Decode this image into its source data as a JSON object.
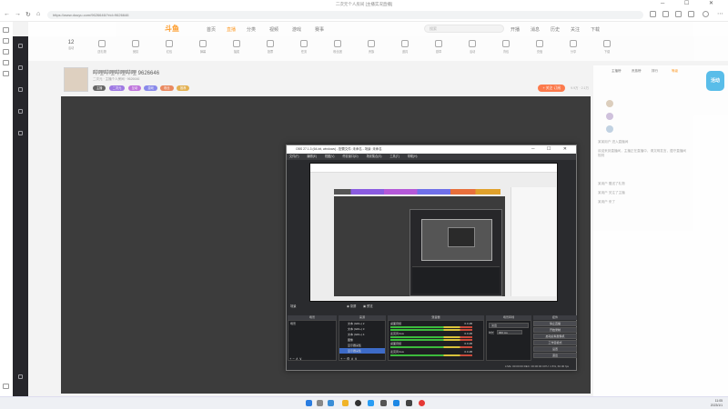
{
  "browser": {
    "title": "二次元个人房间 [主播实况直播]",
    "url": "https://www.douyu.com/9626646/?rid=9626646"
  },
  "site": {
    "logo": "斗鱼",
    "nav": [
      "首页",
      "直播",
      "分类",
      "视频",
      "游戏",
      "赛事",
      "鱼吧"
    ],
    "search_placeholder": "搜索",
    "actions": [
      "开播",
      "消息",
      "历史",
      "关注",
      "下载"
    ],
    "icon_row": [
      "送礼物",
      "竞猜",
      "红包",
      "弹幕",
      "抽奖",
      "投票",
      "任务",
      "粉丝团",
      "贵族",
      "道具",
      "勋章",
      "活动",
      "背包",
      "充值",
      "分享",
      "下载"
    ],
    "activity_badge": "12",
    "activity_label": "活动"
  },
  "room": {
    "title": "哔哩哔哩哔哩哔哩 9626646",
    "meta": "二次元 · 主播个人房间 · 9626646",
    "tags": [
      "主播",
      "二次元",
      "互动",
      "游戏",
      "粉丝",
      "推荐"
    ],
    "follow_button": "+ 关注 订阅",
    "stats": "9.9万 · 2.1万"
  },
  "obs": {
    "title": "OBS 27.1.3 (64-bit, windows) - 配置文件: 未命名 - 场景: 未命名",
    "menu": [
      "文件(F)",
      "编辑(E)",
      "视图(V)",
      "停靠窗口(D)",
      "场景集合(S)",
      "工具(T)",
      "帮助(H)"
    ],
    "studio_mode": "录屏",
    "preview_mode": "预览",
    "current_scene": "场景",
    "docks": {
      "scenes": "场景",
      "sources": "来源",
      "mixer": "混音器",
      "transitions": "场景转场",
      "controls": "控件"
    },
    "scene_items": [
      "场景"
    ],
    "source_items": [
      "文本 (GDI+) 2",
      "文本 (GDI+) 3",
      "文本 (GDI+) 4",
      "图像",
      "显示器采集",
      "显示器采集"
    ],
    "mixer_channels": [
      {
        "name": "桌面音频",
        "level": "0.0 dB"
      },
      {
        "name": "麦克风/Aux",
        "level": "0.0 dB"
      },
      {
        "name": "桌面音频",
        "level": "0.0 dB"
      },
      {
        "name": "麦克风/Aux",
        "level": "0.0 dB"
      }
    ],
    "transition": "淡出",
    "duration_label": "时长",
    "duration_value": "300 ms",
    "controls": [
      "停止直播",
      "开始录制",
      "启动虚拟摄像机",
      "工作室模式",
      "设置",
      "退出"
    ],
    "status": "LIVE: 00:00:00   REC: 00:00:00   CPU: 1.5%, 60.00 fps"
  },
  "chat": {
    "tabs": [
      "主播榜",
      "贵族榜",
      "排行",
      "等级"
    ],
    "messages": [
      "某某用户 进入直播间",
      "欢迎来到直播间，主播正在直播中，请文明发言，遵守直播间规则",
      "某用户 赠送了礼物",
      "某用户 关注了主播",
      "某用户 来了"
    ],
    "badge": "活动"
  },
  "taskbar": {
    "time": "11:05",
    "date": "2023/1/1"
  },
  "colors": {
    "accent": "#ff8a00",
    "obs_select": "#3d6bc8",
    "follow": "#ff5d23"
  }
}
